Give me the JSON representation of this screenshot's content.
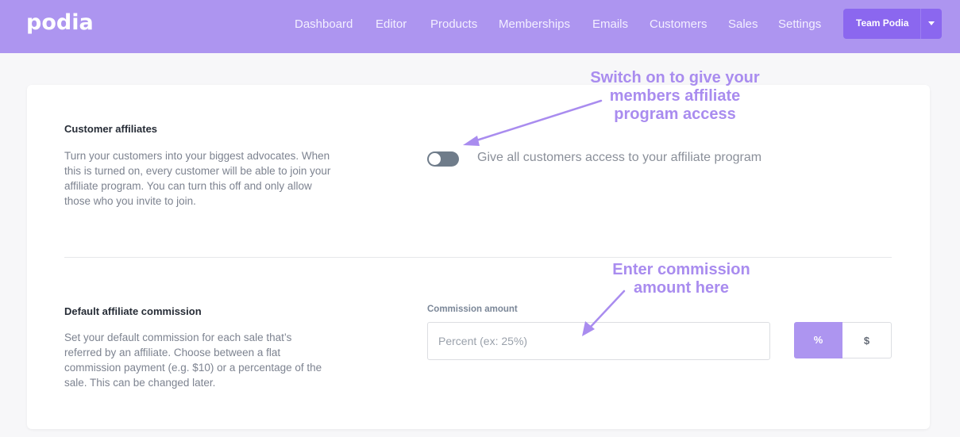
{
  "header": {
    "logo": "podia",
    "nav": [
      "Dashboard",
      "Editor",
      "Products",
      "Memberships",
      "Emails",
      "Customers",
      "Sales",
      "Settings"
    ],
    "team_button": "Team Podia"
  },
  "customer_affiliates": {
    "title": "Customer affiliates",
    "description": "Turn your customers into your biggest advocates. When this is turned on, every customer will be able to join your affiliate program. You can turn this off and only allow those who you invite to join.",
    "toggle_label": "Give all customers access to your affiliate program",
    "toggle_on": false
  },
  "default_commission": {
    "title": "Default affiliate commission",
    "description": "Set your default commission for each sale that’s referred by an affiliate. Choose between a flat commission payment (e.g. $10) or a percentage of the sale. This can be changed later.",
    "field_label": "Commission amount",
    "placeholder": "Percent (ex: 25%)",
    "value": "",
    "unit_options": [
      "%",
      "$"
    ],
    "selected_unit": "%"
  },
  "annotations": {
    "toggle_note": [
      "Switch on to give your",
      "members affiliate",
      "program access"
    ],
    "commission_note": [
      "Enter commission",
      "amount here"
    ]
  },
  "colors": {
    "brand": "#ad95f0",
    "button": "#8b67ef",
    "annotation": "#a98cef"
  },
  "icons": {
    "team_menu": "caret-down-icon",
    "annotation_pointer": "arrow-icon"
  }
}
